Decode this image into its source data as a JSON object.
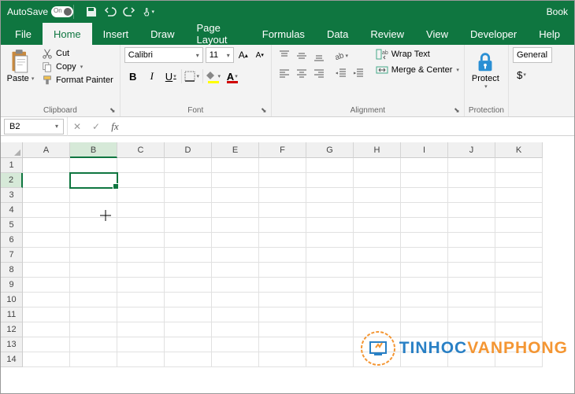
{
  "titlebar": {
    "autosave": "AutoSave",
    "toggle_state": "On",
    "doc": "Book"
  },
  "tabs": [
    "File",
    "Home",
    "Insert",
    "Draw",
    "Page Layout",
    "Formulas",
    "Data",
    "Review",
    "View",
    "Developer",
    "Help"
  ],
  "active_tab": 1,
  "clipboard": {
    "title": "Clipboard",
    "paste": "Paste",
    "cut": "Cut",
    "copy": "Copy",
    "format_painter": "Format Painter"
  },
  "font": {
    "title": "Font",
    "name": "Calibri",
    "size": "11"
  },
  "alignment": {
    "title": "Alignment",
    "wrap": "Wrap Text",
    "merge": "Merge & Center"
  },
  "protection": {
    "title": "Protection",
    "protect": "Protect"
  },
  "number": {
    "format": "General"
  },
  "formula": {
    "cell_ref": "B2",
    "value": ""
  },
  "cols": [
    "A",
    "B",
    "C",
    "D",
    "E",
    "F",
    "G",
    "H",
    "I",
    "J",
    "K"
  ],
  "rows": [
    "1",
    "2",
    "3",
    "4",
    "5",
    "6",
    "7",
    "8",
    "9",
    "10",
    "11",
    "12",
    "13",
    "14"
  ],
  "selected": {
    "col": 1,
    "row": 1
  },
  "watermark": {
    "t1": "TINHOC",
    "t2": "VANPHONG"
  }
}
